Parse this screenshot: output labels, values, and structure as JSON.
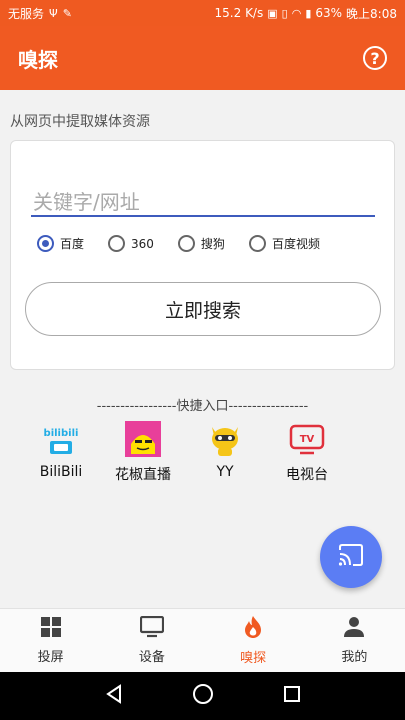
{
  "status": {
    "carrier": "无服务",
    "speed": "15.2 K/s",
    "battery": "63%",
    "time": "晚上8:08"
  },
  "app": {
    "title": "嗅探",
    "help": "?"
  },
  "hint": "从网页中提取媒体资源",
  "search": {
    "placeholder": "关键字/网址",
    "button_label": "立即搜索",
    "options": [
      {
        "label": "百度",
        "selected": true
      },
      {
        "label": "360",
        "selected": false
      },
      {
        "label": "搜狗",
        "selected": false
      },
      {
        "label": "百度视频",
        "selected": false
      }
    ]
  },
  "shortcuts_title": "-----------------快捷入口-----------------",
  "shortcuts": [
    {
      "label": "BiliBili",
      "icon": "bilibili-icon"
    },
    {
      "label": "花椒直播",
      "icon": "huajiao-icon"
    },
    {
      "label": "YY",
      "icon": "yy-icon"
    },
    {
      "label": "电视台",
      "icon": "tv-icon"
    }
  ],
  "fab_icon": "cast-icon",
  "tabs": [
    {
      "label": "投屏",
      "icon": "grid-icon",
      "active": false
    },
    {
      "label": "设备",
      "icon": "monitor-icon",
      "active": false
    },
    {
      "label": "嗅探",
      "icon": "flame-icon",
      "active": true
    },
    {
      "label": "我的",
      "icon": "person-icon",
      "active": false
    }
  ],
  "colors": {
    "primary": "#f05a22",
    "accent": "#3d5bbd",
    "fab": "#5b7df4"
  }
}
